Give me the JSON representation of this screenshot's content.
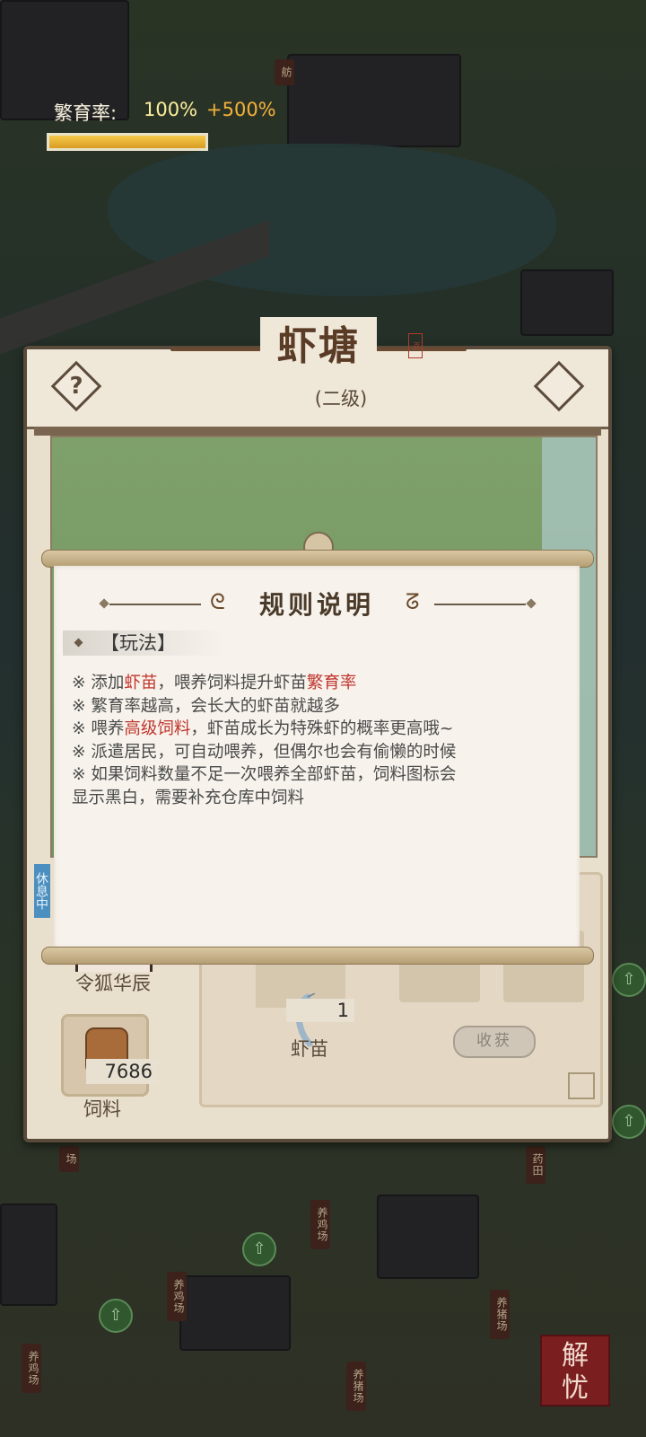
{
  "building": {
    "title": "虾塘",
    "level": "(二级)"
  },
  "breeding": {
    "label": "繁育率:",
    "value": "100%",
    "bonus": "+500%",
    "progress_fraction": 1.0
  },
  "resident": {
    "name": "令狐华辰"
  },
  "feed": {
    "count": "7686",
    "label": "饲料"
  },
  "shrimp": {
    "count": "1",
    "label": "虾苗"
  },
  "harvest_button": "收获",
  "rules_dialog": {
    "title": "规则说明",
    "section": "【玩法】",
    "lines": [
      [
        "※  添加",
        "虾苗",
        "，喂养饲料提升虾苗",
        "繁育率"
      ],
      [
        "※  繁育率越高，会长大的虾苗就越多"
      ],
      [
        "※  喂养",
        "高级饲料",
        "，虾苗成长为特殊虾的概率更高哦~"
      ],
      [
        "※  派遣居民，可自动喂养，但偶尔也会有偷懒的时候"
      ],
      [
        "※  如果饲料数量不足一次喂养全部虾苗，饲料图标会"
      ],
      [
        "显示黑白，需要补充仓库中饲料"
      ]
    ]
  },
  "map_signs": [
    "舫",
    "养鸡场",
    "养鸡场",
    "养鸡场",
    "养猪场",
    "养猪场",
    "场",
    "药田"
  ],
  "status_tag": "休息中",
  "logo_text": [
    "解",
    "忧"
  ],
  "colors": {
    "highlight": "#c0352d",
    "bonus": "#f2b13a",
    "panel_border": "#5a4a3a"
  }
}
